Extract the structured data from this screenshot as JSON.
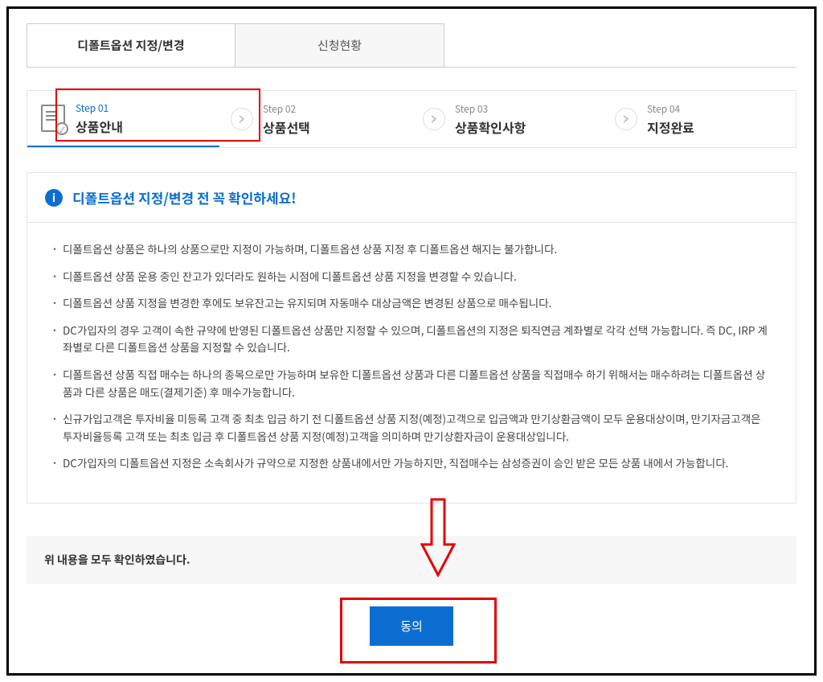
{
  "tabs": [
    {
      "label": "디폴트옵션 지정/변경"
    },
    {
      "label": "신청현황"
    }
  ],
  "steps": [
    {
      "label": "Step 01",
      "title": "상품안내"
    },
    {
      "label": "Step 02",
      "title": "상품선택"
    },
    {
      "label": "Step 03",
      "title": "상품확인사항"
    },
    {
      "label": "Step 04",
      "title": "지정완료"
    }
  ],
  "notice": {
    "title": "디폴트옵션 지정/변경 전 꼭 확인하세요!",
    "items": [
      "디폴트옵션 상품은 하나의 상품으로만 지정이 가능하며, 디폴트옵션 상품 지정 후 디폴트옵션 해지는 불가합니다.",
      "디폴트옵션 상품 운용 중인 잔고가 있더라도 원하는 시점에 디폴트옵션 상품 지정을 변경할 수 있습니다.",
      "디폴트옵션 상품 지정을 변경한 후에도 보유잔고는 유지되며 자동매수 대상금액은 변경된 상품으로 매수됩니다.",
      "DC가입자의 경우 고객이 속한 규약에 반영된 디폴트옵션 상품만 지정할 수 있으며, 디폴트옵션의 지정은 퇴직연금 계좌별로 각각 선택 가능합니다. 즉 DC, IRP 계좌별로 다른 디폴트옵션 상품을 지정할 수 있습니다.",
      "디폴트옵션 상품 직접 매수는 하나의 종목으로만 가능하며 보유한 디폴트옵션 상품과 다른 디폴트옵션 상품을 직접매수 하기 위해서는 매수하려는 디폴트옵션 상품과 다른 상품은 매도(결제기준) 후 매수가능합니다.",
      "신규가입고객은 투자비율 미등록 고객 중 최초 입금 하기 전 디폴트옵션 상품 지정(예정)고객으로 입금액과 만기상환금액이 모두 운용대상이며, 만기자금고객은 투자비율등록 고객 또는 최초 입금 후 디폴트옵션 상품 지정(예정)고객을 의미하며 만기상환자금이 운용대상입니다.",
      "DC가입자의 디폴트옵션 지정은 소속회사가 규약으로 지정한 상품내에서만 가능하지만, 직접매수는 삼성증권이 승인 받은 모든 상품 내에서 가능합니다."
    ]
  },
  "confirm": {
    "text": "위 내용을 모두 확인하였습니다.",
    "button": "동의"
  }
}
